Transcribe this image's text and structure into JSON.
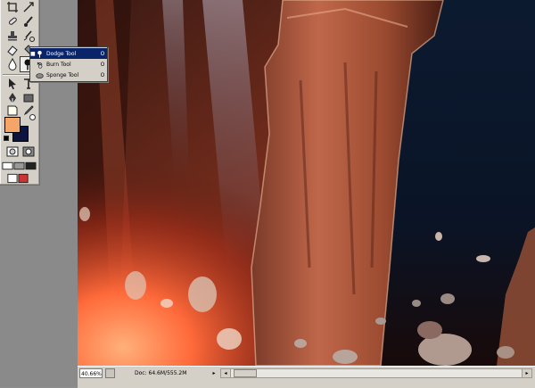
{
  "flyout": {
    "items": [
      {
        "label": "Dodge Tool",
        "key": "O",
        "icon": "dodge-icon",
        "selected": true
      },
      {
        "label": "Burn Tool",
        "key": "O",
        "icon": "burn-icon",
        "selected": false
      },
      {
        "label": "Sponge Tool",
        "key": "O",
        "icon": "sponge-icon",
        "selected": false
      }
    ]
  },
  "tools": {
    "foreground_color": "#f5a567",
    "background_color": "#0c1340",
    "icons": [
      "crop-icon",
      "slice-icon",
      "healing-brush-icon",
      "brush-icon",
      "clone-stamp-icon",
      "history-brush-icon",
      "eraser-icon",
      "paint-bucket-icon",
      "blur-icon",
      "dodge-icon",
      "path-select-icon",
      "type-icon",
      "pen-icon",
      "shape-icon",
      "notes-icon",
      "eyedropper-icon",
      "hand-icon",
      "zoom-icon",
      "quick-mask-icon",
      "screen-mode-icon",
      "jump-to-icon"
    ]
  },
  "status": {
    "zoom": "40.66%",
    "doc": "Doc: 64.6M/555.2M",
    "arrow": "▸",
    "scroll_left": "◂",
    "scroll_right": "▸"
  }
}
